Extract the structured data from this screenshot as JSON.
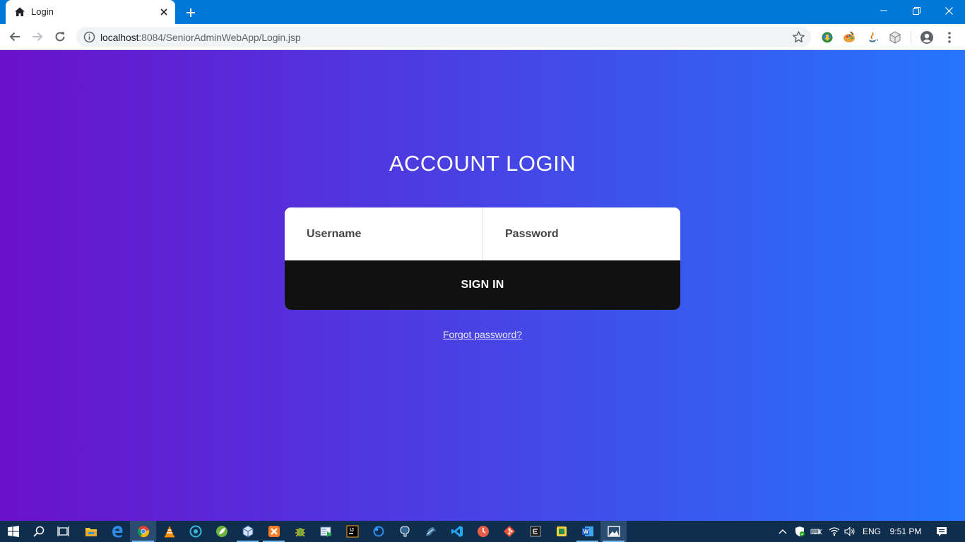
{
  "browser": {
    "tab_title": "Login",
    "url_host": "localhost",
    "url_rest": ":8084/SeniorAdminWebApp/Login.jsp"
  },
  "page": {
    "heading": "ACCOUNT LOGIN",
    "username_placeholder": "Username",
    "password_placeholder": "Password",
    "signin_label": "SIGN IN",
    "forgot_label": "Forgot password?"
  },
  "taskbar": {
    "language": "ENG",
    "time": "9:51 PM"
  },
  "colors": {
    "tabstrip": "#0078d7",
    "gradient_start": "#6a11cb",
    "gradient_end": "#2575fc",
    "signin_bg": "#111111",
    "taskbar": "#0f2d4c"
  },
  "icons": {
    "tab_favicon": "home-icon",
    "extensions": [
      "idm-icon",
      "paint-icon",
      "java-icon",
      "cube-extension-icon"
    ],
    "taskbar_apps": [
      "file-explorer-icon",
      "edge-icon",
      "chrome-icon",
      "vlc-icon",
      "app-icon",
      "spring-icon",
      "virtualbox-icon",
      "xampp-icon",
      "bug-icon",
      "media-icon",
      "intellij-icon",
      "cloud-icon",
      "postgres-icon",
      "mysql-icon",
      "vscode-icon",
      "clock-app-icon",
      "git-icon",
      "eclipse-icon",
      "sticky-icon",
      "word-icon",
      "photos-icon"
    ]
  }
}
